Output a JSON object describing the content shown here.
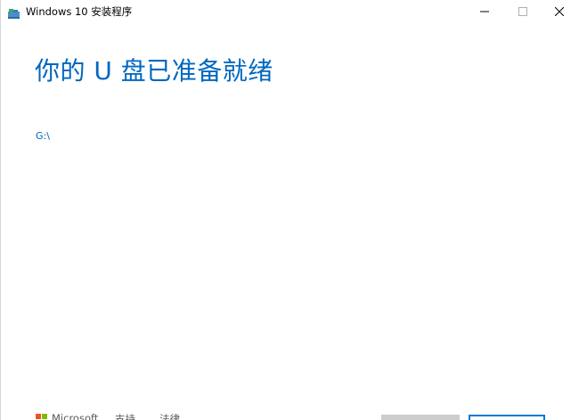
{
  "window": {
    "title": "Windows 10 安装程序"
  },
  "main": {
    "heading": "你的 U 盘已准备就绪",
    "drive": "G:\\"
  },
  "footer": {
    "brand": "Microsoft",
    "support": "支持",
    "legal": "法律"
  },
  "colors": {
    "accent": "#0067c0",
    "button_border": "#0078d7",
    "disabled_button": "#cccccc"
  }
}
